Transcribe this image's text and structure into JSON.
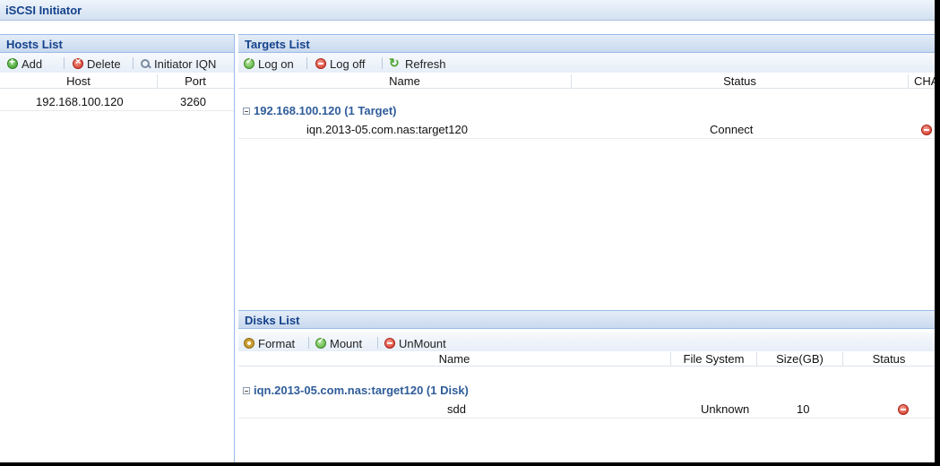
{
  "window": {
    "title": "iSCSI Initiator"
  },
  "hosts": {
    "header": "Hosts List",
    "toolbar": {
      "add": "Add",
      "delete": "Delete",
      "initiator_iqn": "Initiator IQN"
    },
    "columns": {
      "host": "Host",
      "port": "Port"
    },
    "rows": [
      {
        "host": "192.168.100.120",
        "port": "3260"
      }
    ]
  },
  "targets": {
    "header": "Targets List",
    "toolbar": {
      "logon": "Log on",
      "logoff": "Log off",
      "refresh": "Refresh"
    },
    "columns": {
      "name": "Name",
      "status": "Status",
      "chap": "CHAP"
    },
    "group": "192.168.100.120 (1 Target)",
    "rows": [
      {
        "name": "iqn.2013-05.com.nas:target120",
        "status": "Connect"
      }
    ]
  },
  "disks": {
    "header": "Disks List",
    "toolbar": {
      "format": "Format",
      "mount": "Mount",
      "unmount": "UnMount"
    },
    "columns": {
      "name": "Name",
      "filesystem": "File System",
      "size": "Size(GB)",
      "status": "Status"
    },
    "group": "iqn.2013-05.com.nas:target120 (1 Disk)",
    "rows": [
      {
        "name": "sdd",
        "filesystem": "Unknown",
        "size": "10"
      }
    ]
  }
}
